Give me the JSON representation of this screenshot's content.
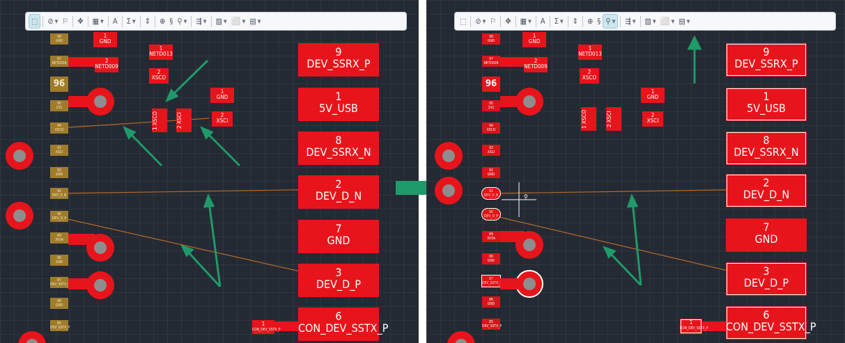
{
  "toolbar": {
    "items": [
      "select",
      "route",
      "flag",
      "move",
      "grid",
      "text",
      "sum",
      "align",
      "target",
      "link",
      "probe",
      "dist",
      "fill",
      "frame",
      "panel"
    ],
    "icons": {
      "select": "⬚",
      "route": "⊘",
      "flag": "⚐",
      "move": "✥",
      "grid": "▦",
      "text": "A",
      "sum": "Σ",
      "align": "⇕",
      "target": "⊕",
      "link": "§",
      "probe": "⚲",
      "dist": "⇶",
      "fill": "▨",
      "frame": "⬜",
      "panel": "▤"
    }
  },
  "pins_left": [
    {
      "n": "98",
      "net": "GND"
    },
    {
      "n": "97",
      "net": "NETD009"
    },
    {
      "n": "95",
      "net": "1V1"
    },
    {
      "n": "94",
      "net": "XSCO"
    },
    {
      "n": "93",
      "net": "XSCI"
    },
    {
      "n": "92",
      "net": "GND"
    },
    {
      "n": "91",
      "net": "DEV_D_N"
    },
    {
      "n": "90",
      "net": "DEV_D_P"
    },
    {
      "n": "89",
      "net": "3V3A"
    },
    {
      "n": "88",
      "net": "GND"
    },
    {
      "n": "87",
      "net": "DEV_SSTX_N"
    },
    {
      "n": "86",
      "net": "GND"
    },
    {
      "n": "85",
      "net": "DEV_SSTX_P"
    }
  ],
  "pin_big": "96",
  "small_pads": {
    "gnd_top": {
      "n": "1",
      "net": "GND"
    },
    "netd013": {
      "n": "1",
      "net": "NETD013"
    },
    "netd009": {
      "n": "2",
      "net": "NETD009"
    },
    "xsco_2": {
      "n": "2",
      "net": "XSCO"
    },
    "gnd_mid": {
      "n": "1",
      "net": "GND"
    },
    "xsci_2": {
      "n": "2",
      "net": "XSCI"
    },
    "xsco_v": {
      "n": "1",
      "net": "XSCO"
    },
    "xsci_v": {
      "n": "2",
      "net": "XSCI"
    },
    "con": {
      "n": "1",
      "net": "CON_DEV_SSTX_P"
    }
  },
  "big_pads": [
    {
      "n": "9",
      "net": "DEV_SSRX_P"
    },
    {
      "n": "1",
      "net": "5V_USB"
    },
    {
      "n": "8",
      "net": "DEV_SSRX_N"
    },
    {
      "n": "2",
      "net": "DEV_D_N"
    },
    {
      "n": "7",
      "net": "GND"
    },
    {
      "n": "3",
      "net": "DEV_D_P"
    },
    {
      "n": "6",
      "net": "CON_DEV_SSTX_P"
    }
  ],
  "colors": {
    "pad": "#e8141b",
    "arrow": "#1f9a6a",
    "board": "#242a33",
    "pin": "#a07c2a",
    "trace": "#b66a2a"
  }
}
